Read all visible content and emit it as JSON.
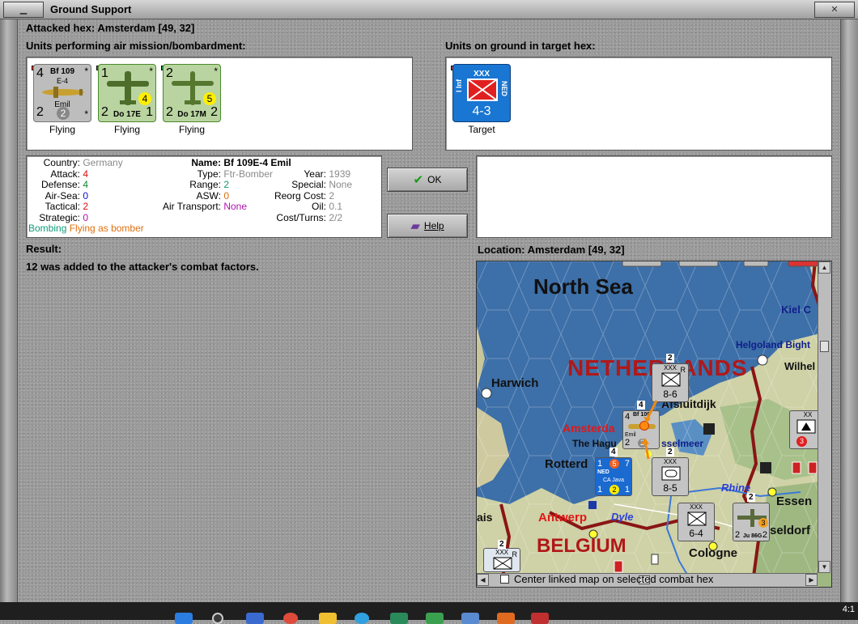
{
  "window": {
    "title": "Ground Support",
    "minimize_glyph": "▁",
    "close_glyph": "✕"
  },
  "header": {
    "attacked_hex": "Attacked hex: Amsterdam  [49, 32]",
    "air_units_label": "Units performing air mission/bombardment:",
    "ground_units_label": "Units on ground in target hex:"
  },
  "air_units": [
    {
      "caption": "Flying",
      "name": "Bf 109",
      "variant": "E-4",
      "sub": "Emil",
      "attack": "4",
      "defense": "2",
      "badge": "2",
      "corner_tr": "*",
      "corner_br": "*",
      "style": "gray"
    },
    {
      "caption": "Flying",
      "name": "Do 17E",
      "attack": "1",
      "defense": "2",
      "range": "1",
      "badge": "4",
      "corner_tr": "*",
      "style": "green"
    },
    {
      "caption": "Flying",
      "name": "Do 17M",
      "attack": "2",
      "defense": "2",
      "range": "2",
      "badge": "5",
      "corner_tr": "*",
      "style": "green"
    }
  ],
  "ground_units": [
    {
      "caption": "Target",
      "size": "XXX",
      "type": "I Inf",
      "nation": "NED",
      "strength": "4-3"
    }
  ],
  "unit_stats": {
    "country_label": "Country:",
    "country": "Germany",
    "attack_label": "Attack:",
    "attack": "4",
    "defense_label": "Defense:",
    "defense": "4",
    "airsea_label": "Air-Sea:",
    "airsea": "0",
    "tactical_label": "Tactical:",
    "tactical": "2",
    "strategic_label": "Strategic:",
    "strategic": "0",
    "name_label": "Name:",
    "name": "Bf 109E-4 Emil",
    "type_label": "Type:",
    "type": "Ftr-Bomber",
    "range_label": "Range:",
    "range": "2",
    "asw_label": "ASW:",
    "asw": "0",
    "air_transport_label": "Air Transport:",
    "air_transport": "None",
    "year_label": "Year:",
    "year": "1939",
    "special_label": "Special:",
    "special": "None",
    "reorg_label": "Reorg Cost:",
    "reorg": "2",
    "oil_label": "Oil:",
    "oil": "0.1",
    "cost_label": "Cost/Turns:",
    "cost": "2/2",
    "mission": "Bombing",
    "mission_detail": "Flying as bomber"
  },
  "buttons": {
    "ok_label": "OK",
    "help_label": "Help"
  },
  "result": {
    "label": "Result:",
    "text": "12 was added to the attacker's combat factors."
  },
  "location": {
    "label": "Location:  Amsterdam  [49, 32]"
  },
  "map": {
    "labels": {
      "north_sea": "North Sea",
      "netherlands": "NETHERLANDS",
      "belgium": "BELGIUM",
      "harwich": "Harwich",
      "kiel": "Kiel C",
      "helgoland": "Helgoland Bight",
      "wilhelm": "Wilhel",
      "afsluitdijk": "Afsluitdijk",
      "amsterdam": "Amsterda",
      "the_hague": "The Hagu",
      "ijsselmeer": "sselmeer",
      "rotterdam": "Rotterd",
      "rhine": "Rhine",
      "essen": "Essen",
      "antwerp": "Antwerp",
      "dyle": "Dyle",
      "dusseldorf": "seldorf",
      "cologne": "Cologne",
      "calais": "ais"
    },
    "counters": {
      "top_size": "XXX",
      "top_corner": "R",
      "top_strength": "8-6",
      "top_stack": "2",
      "mid_size": "XXX",
      "mid_strength": "8-5",
      "mid_stack": "2",
      "bf_name": "Bf 109",
      "bf_sub": "Emil",
      "bf_attack": "4",
      "bf_defense": "2",
      "bf_badge": "2",
      "bf_stack": "4",
      "ned_text": "NED",
      "ned_sub": "CA Java",
      "ned_tl": "1",
      "ned_tr": "7",
      "ned_bl": "1",
      "ned_br": "1",
      "ned_badge": "5",
      "ned_badge2": "2",
      "ned_stack": "4",
      "xxi_size": "XXX",
      "xxi_strength": "6-4",
      "ju_name": "Ju 86G",
      "ju_left": "2",
      "ju_right": "2",
      "ju_badge": "3",
      "ju_stack": "2",
      "right_size": "XX",
      "right_badge": "3",
      "right_strength": "3",
      "bottom_left_size": "XXX",
      "bottom_left_corner": "R",
      "bottom_left_stack": "2"
    }
  },
  "center_linked_label": "Center linked map on selected combat hex",
  "taskbar": {
    "time": "4:1"
  }
}
